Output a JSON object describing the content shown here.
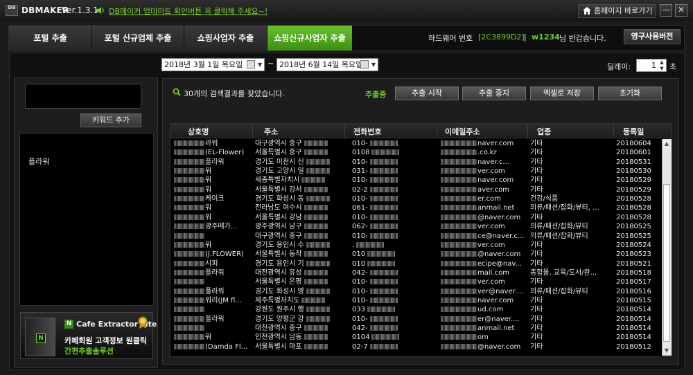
{
  "titlebar": {
    "logo": "DB",
    "app_name": "DBMAKER",
    "version": "Ver.1.3.1",
    "notice": "DB메이커 업데이트 확인버튼 꼭 클릭해 주세요~!",
    "homepage_button": "홈페이지 바로가기",
    "minimize": "—",
    "close": "✕"
  },
  "tabs": [
    {
      "label": "포털 추출",
      "active": false
    },
    {
      "label": "포털 신규업체 추출",
      "active": false
    },
    {
      "label": "쇼핑사업자 추출",
      "active": false
    },
    {
      "label": "쇼핑신규사업자 추출",
      "active": true
    }
  ],
  "account": {
    "hw_label": "하드웨어 번호",
    "hw_code": "[2C3899D2]",
    "separator": "|",
    "user_id": "w1234",
    "greeting": "님 반갑습니다.",
    "license_button": "영구사용버전"
  },
  "filters": {
    "date_start": "2018년  3월  1일 목요일",
    "date_end": "2018년  6월 14일 목요일",
    "tilde": "~",
    "delay_label": "딜레이:",
    "delay_value": "1",
    "delay_unit": "초"
  },
  "sidebar": {
    "keyword_input_value": "",
    "add_keyword_button": "키워드 추가",
    "keywords": [
      "플라워"
    ]
  },
  "ad": {
    "n_logo": "N",
    "product": "Cafe Extractor Lite",
    "line1": "카페회원 고객정보 원클릭",
    "line2": "간편추출솔루션"
  },
  "results": {
    "summary": "30개의 검색결과를 찾았습니다.",
    "status": "추출중",
    "buttons": {
      "start": "추출 시작",
      "stop": "추출 중지",
      "excel": "엑셀로 저장",
      "reset": "초기화"
    }
  },
  "table": {
    "columns": [
      "상호명",
      "주소",
      "전화번호",
      "이메일주소",
      "업종",
      "등록일"
    ],
    "rows": [
      [
        "라워",
        "대구광역시 중구",
        "010-",
        "naver.com",
        "기타",
        "20180604"
      ],
      [
        "(EL-Flower)",
        "서울특별시 중구",
        "0108",
        ".co.kr",
        "기타",
        "20180601"
      ],
      [
        "플라워",
        "경기도 이천시 신",
        "010-",
        "naver.c...",
        "기타",
        "20180531"
      ],
      [
        "워",
        "경기도 고양시 일",
        "031-",
        "ver.com",
        "기타",
        "20180530"
      ],
      [
        "워",
        "세종특별자치시",
        "010-",
        "naver.com",
        "기타",
        "20180529"
      ],
      [
        "워",
        "서울특별시 강서",
        "02-2",
        "aver.com",
        "기타",
        "20180529"
      ],
      [
        "케이크",
        "경기도 화성시 동",
        "010-",
        "er.com",
        "건강/식품",
        "20180528"
      ],
      [
        "워",
        "전라남도 여수시",
        "061-",
        "anmail.net",
        "의류/패션/잡화/뷰티, ...",
        "20180528"
      ],
      [
        "워",
        "서울특별시 강남",
        "010-",
        "@naver.com",
        "기타",
        "20180528"
      ],
      [
        "광주메가...",
        "광주광역시 남구",
        "062-",
        "ver.com",
        "의류/패션/잡화/뷰티",
        "20180525"
      ],
      [
        "",
        "대구광역시 중구",
        "010-",
        "ce@naver.c...",
        "의류/패션/잡화/뷰티",
        "20180525"
      ],
      [
        "워",
        "경기도 용인시 수",
        ".",
        "ver.com",
        "기타",
        "20180524"
      ],
      [
        "(J.FLOWER)",
        "서울특별시 동작",
        "010",
        "@naver.com",
        "기타",
        "20180523"
      ],
      [
        "시피",
        "경기도 용인시 기",
        "010",
        "ecipe@nav...",
        "기타",
        "20180521"
      ],
      [
        "플라워",
        "대전광역시 유성",
        "042-",
        "mail.com",
        "종합몰, 교육/도서/완...",
        "20180518"
      ],
      [
        "",
        "서울특별시 은평",
        "010-",
        "ver.com",
        "기타",
        "20180517"
      ],
      [
        "플라워",
        "경기도 화성시 병",
        "010-",
        "ver@naver....",
        "의류/패션/잡화/뷰티",
        "20180516"
      ],
      [
        "워리(JM fl...",
        "제주특별자치도",
        "010-",
        "naver.com",
        "기타",
        "20180515"
      ],
      [
        "",
        "강원도 원주시 행",
        "033",
        "ud.com",
        "기타",
        "20180514"
      ],
      [
        "플라워",
        "경기도 양평군 강",
        "010-",
        "er@naver....",
        "기타",
        "20180514"
      ],
      [
        "",
        "대전광역시 중구",
        "042-",
        "anmail.net",
        "기타",
        "20180514"
      ],
      [
        "워",
        "인천광역시 남동",
        "0104",
        "om",
        "기타",
        "20180514"
      ],
      [
        "(Damda Fl...",
        "서울특별시 마포",
        "02-7",
        "@naver.com",
        "기타",
        "20180512"
      ]
    ]
  },
  "scrollbar": {
    "up": "▲",
    "down": "▼"
  },
  "colors": {
    "accent": "#6fd12a",
    "tab_active": "#4fa81e",
    "background": "#1b1b1b"
  }
}
